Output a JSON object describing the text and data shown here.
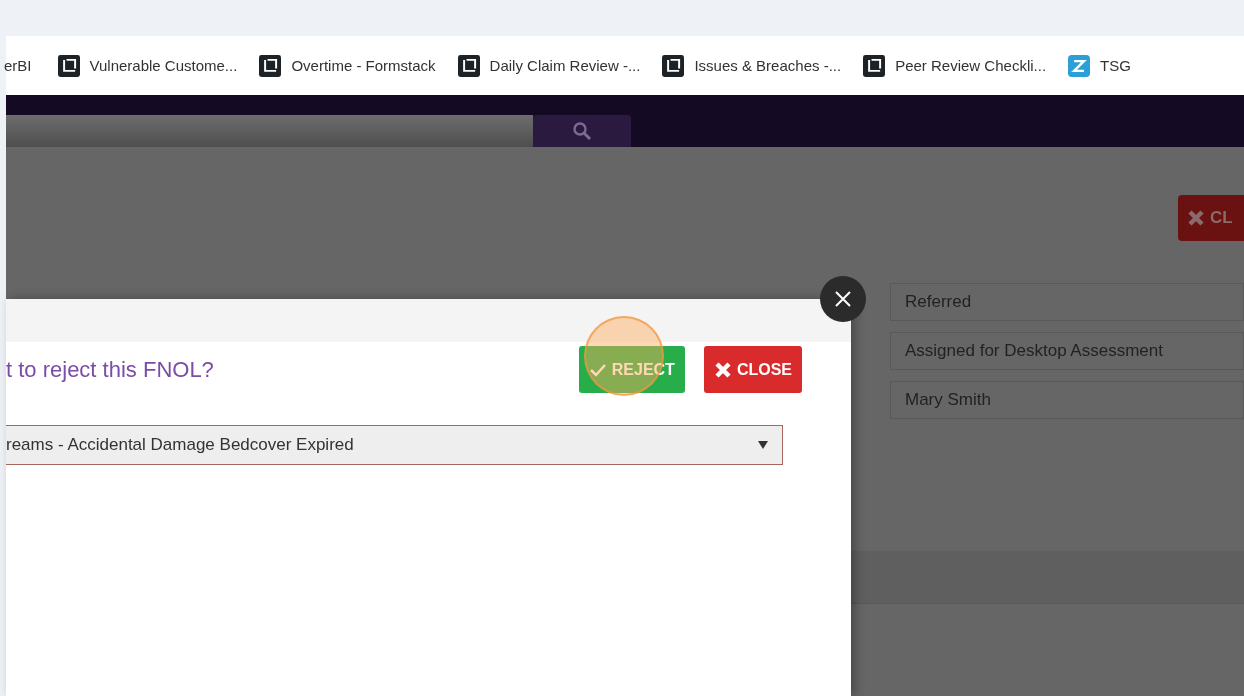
{
  "bookmarks": [
    {
      "label": "erBI",
      "kind": "plain"
    },
    {
      "label": "Vulnerable Custome...",
      "kind": "page"
    },
    {
      "label": "Overtime - Formstack",
      "kind": "page"
    },
    {
      "label": "Daily Claim Review -...",
      "kind": "page"
    },
    {
      "label": "Issues & Breaches -...",
      "kind": "page"
    },
    {
      "label": "Peer Review Checkli...",
      "kind": "page"
    },
    {
      "label": "TSG",
      "kind": "app"
    }
  ],
  "background": {
    "close_button": "CL",
    "fields": [
      {
        "value": "Referred"
      },
      {
        "value": "Assigned for Desktop Assessment"
      },
      {
        "value": "Mary Smith"
      }
    ]
  },
  "dialog": {
    "title": "t to reject this FNOL?",
    "buttons": [
      {
        "label": "REJECT",
        "kind": "confirm"
      },
      {
        "label": "CLOSE",
        "kind": "cancel"
      }
    ],
    "select": {
      "value": "reams - Accidental Damage Bedcover Expired"
    }
  }
}
